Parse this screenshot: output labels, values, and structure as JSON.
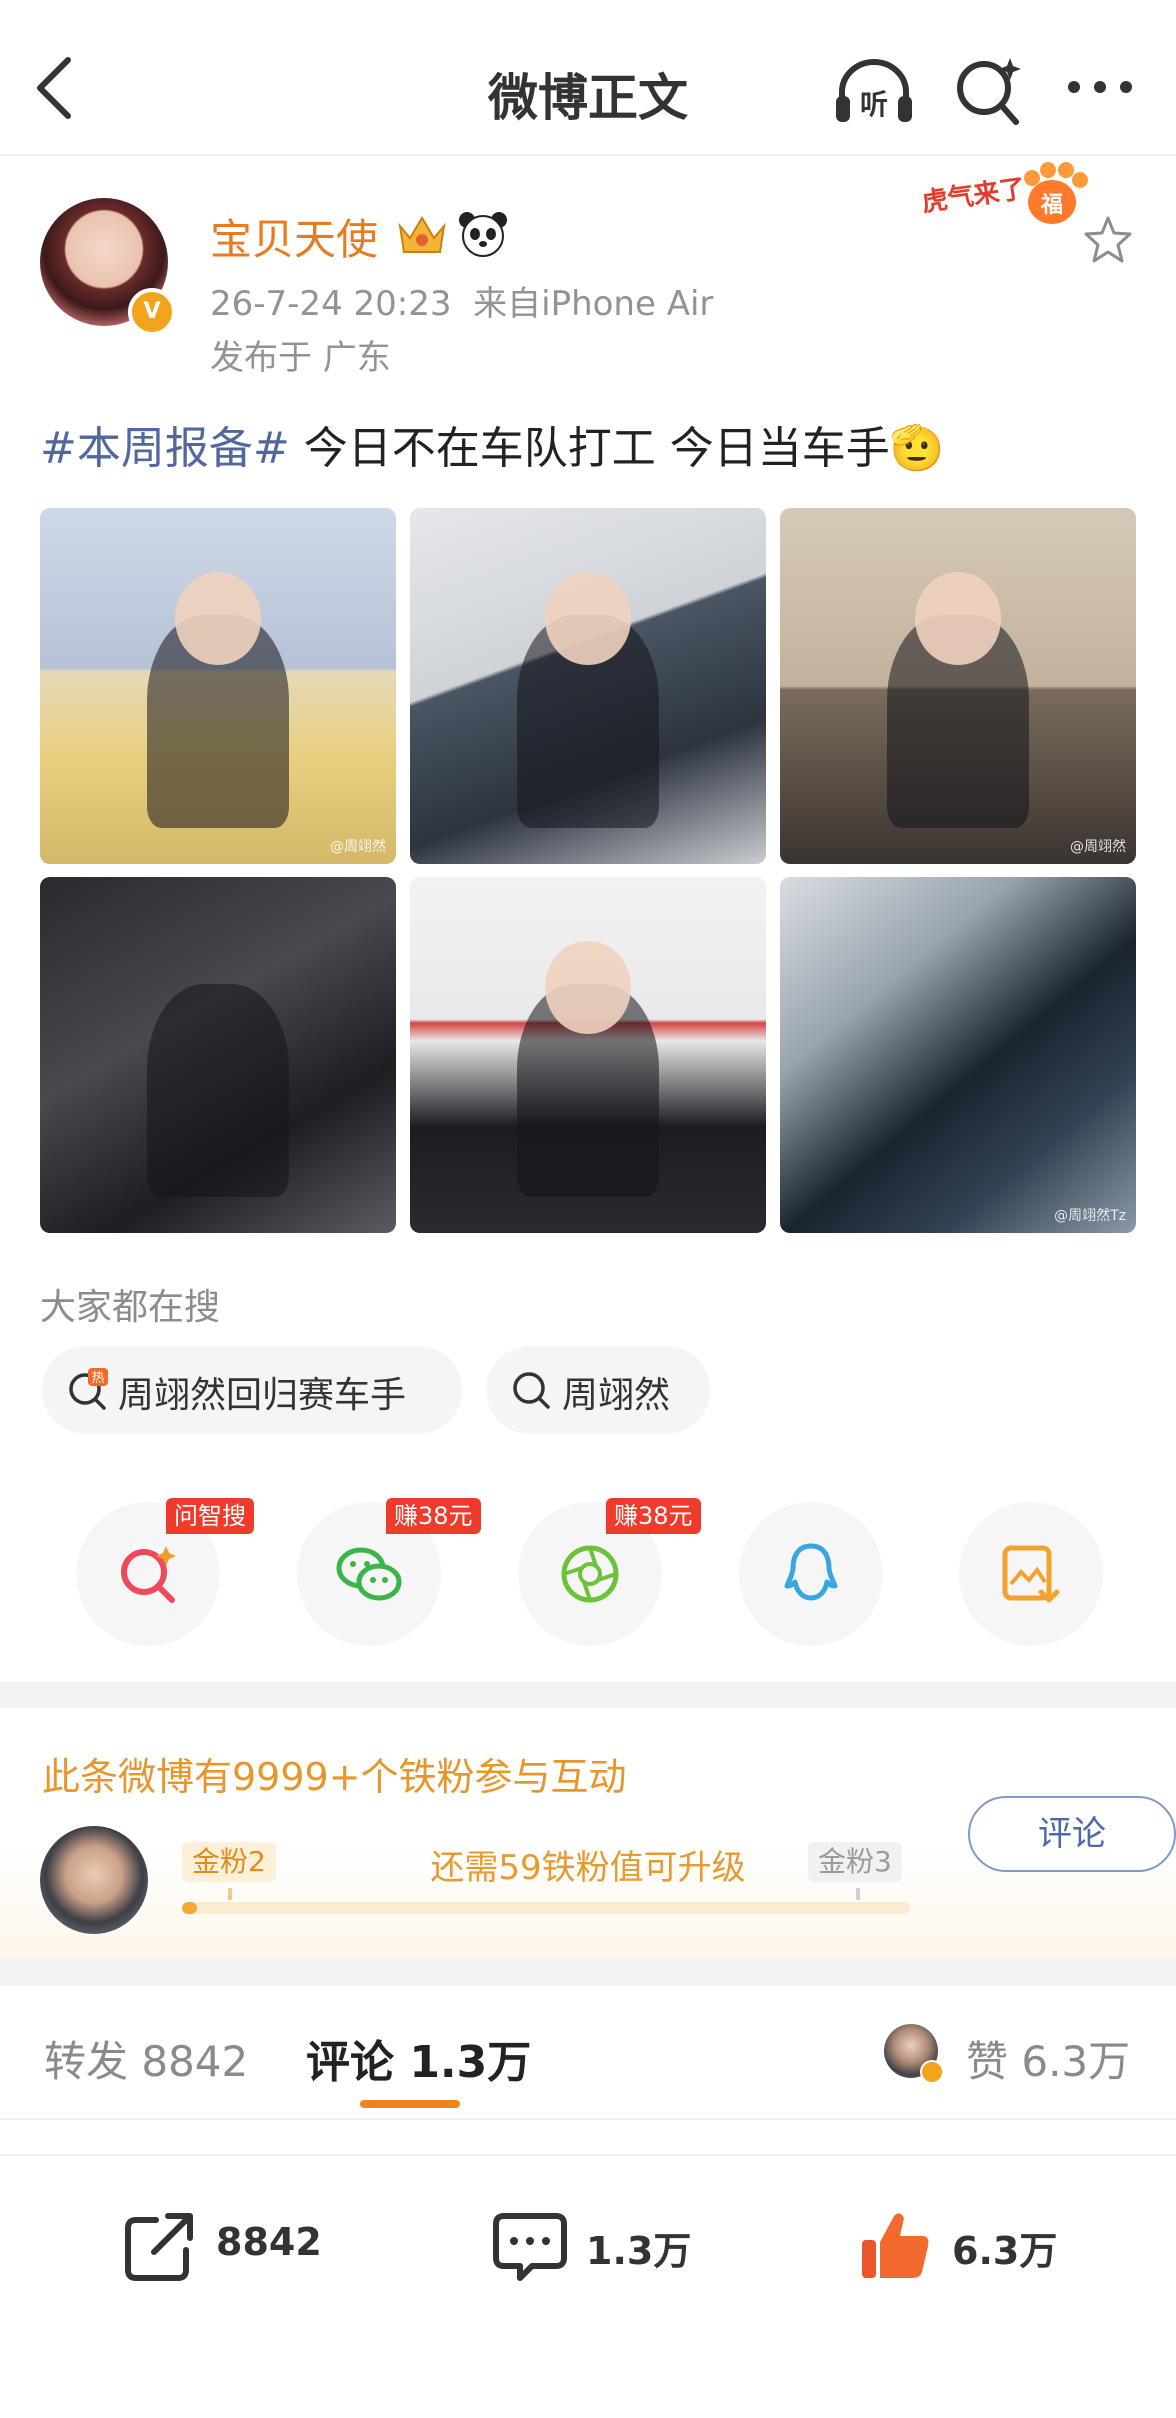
{
  "header": {
    "title": "微博正文"
  },
  "post": {
    "author": "宝贝天使",
    "time": "26-7-24 20:23",
    "source": "来自iPhone Air",
    "location": "发布于 广东",
    "hashtag": "#本周报备#",
    "text": " 今日不在车队打工  今日当车手",
    "emoji": "🫡"
  },
  "images": [
    {
      "watermark": "@周翊然"
    },
    {
      "watermark": ""
    },
    {
      "watermark": "@周翊然"
    },
    {
      "watermark": ""
    },
    {
      "watermark": ""
    },
    {
      "watermark": "@周翊然Tz"
    }
  ],
  "search": {
    "label": "大家都在搜",
    "items": [
      "周翊然回归赛车手",
      "周翊然"
    ]
  },
  "share_tags": {
    "ai_search": "问智搜",
    "wechat": "赚38元",
    "moments": "赚38元"
  },
  "fans": {
    "title": "此条微博有9999+个铁粉参与互动",
    "level_current": "金粉2",
    "level_next": "金粉3",
    "hint": "还需59铁粉值可升级",
    "progress": 0.02,
    "comment_button": "评论"
  },
  "tabs": {
    "forward": "转发 8842",
    "comment": "评论 1.3万",
    "like": "赞 6.3万"
  },
  "actions": {
    "forward": "8842",
    "comment": "1.3万",
    "like": "6.3万"
  },
  "colors": {
    "accent": "#eb7a1f",
    "link": "#52679b",
    "fans": "#e8962c"
  }
}
